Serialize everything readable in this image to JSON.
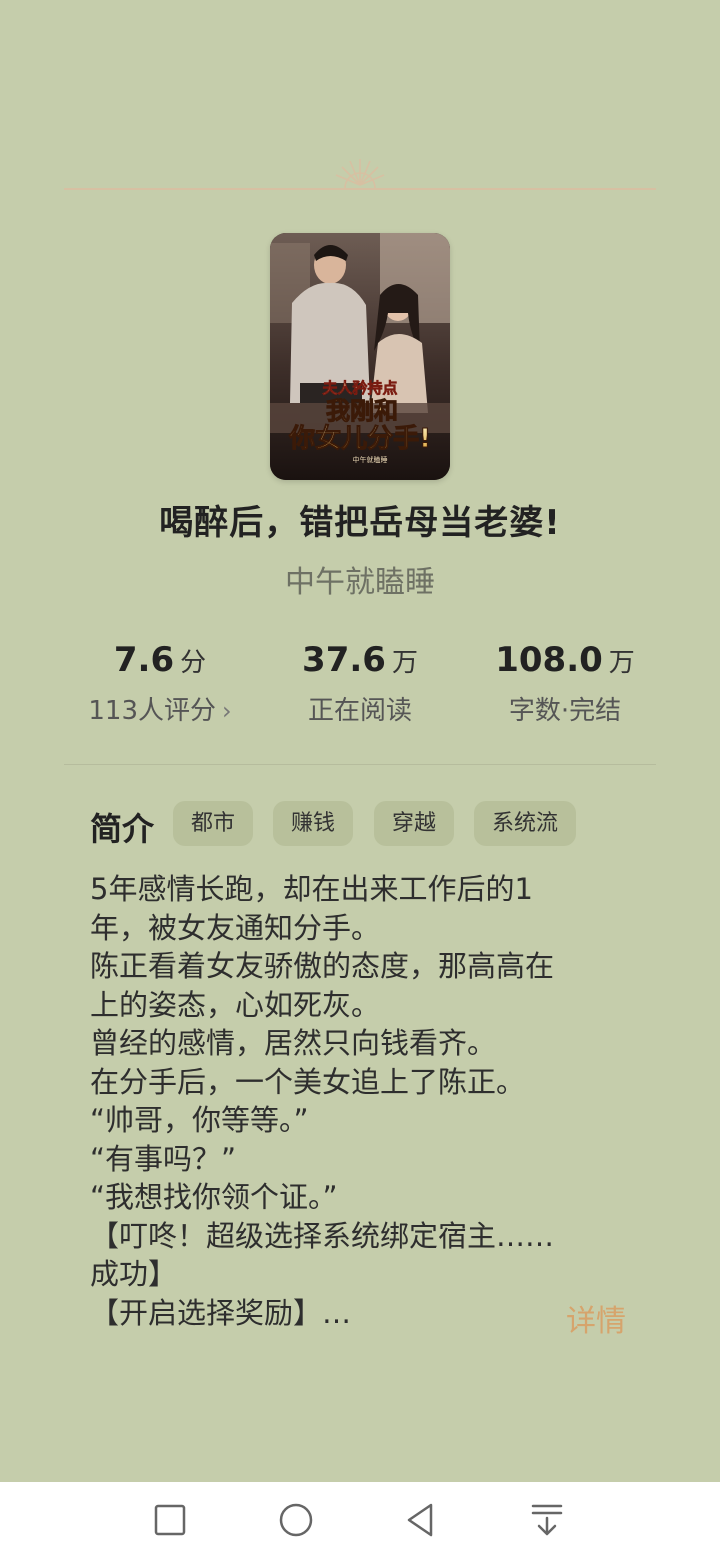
{
  "book": {
    "title": "喝醉后，错把岳母当老婆!",
    "author": "中午就瞌睡",
    "cover": {
      "series_line": "夫人矜持点",
      "title_line1": "我刚和",
      "title_line2": "你女儿分手!",
      "author_small": "中午就瞌睡"
    }
  },
  "stats": [
    {
      "value": "7.6",
      "unit": "分",
      "label": "113人评分"
    },
    {
      "value": "37.6",
      "unit": "万",
      "label": "正在阅读"
    },
    {
      "value": "108.0",
      "unit": "万",
      "label": "字数·完结"
    }
  ],
  "intro": {
    "label": "简介",
    "tags": [
      "都市",
      "赚钱",
      "穿越",
      "系统流"
    ],
    "lines": [
      "5年感情长跑，却在出来工作后的1",
      "年，被女友通知分手。",
      "陈正看着女友骄傲的态度，那高高在",
      "上的姿态，心如死灰。",
      "曾经的感情，居然只向钱看齐。",
      "在分手后，一个美女追上了陈正。",
      "“帅哥，你等等。”",
      "“有事吗？”",
      "“我想找你领个证。”",
      "【叮咚！超级选择系统绑定宿主……",
      "成功】",
      "【开启选择奖励】…"
    ],
    "more_label": "详情"
  },
  "colors": {
    "background": "#c5cdab",
    "accent": "#d6a46c",
    "tag_bg": "#b8c09b"
  },
  "navbar": {
    "icons": [
      "square-icon",
      "circle-icon",
      "triangle-back-icon",
      "download-icon"
    ]
  }
}
